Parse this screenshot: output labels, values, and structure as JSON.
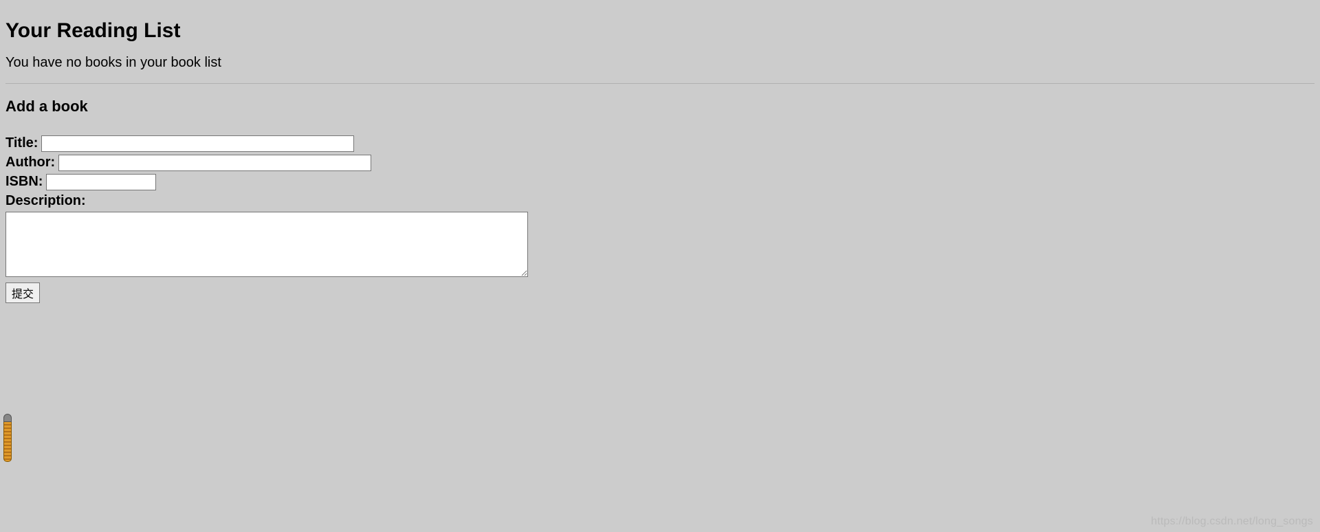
{
  "heading": "Your Reading List",
  "emptyMessage": "You have no books in your book list",
  "form": {
    "heading": "Add a book",
    "labels": {
      "title": "Title:",
      "author": "Author:",
      "isbn": "ISBN:",
      "description": "Description:"
    },
    "values": {
      "title": "",
      "author": "",
      "isbn": "",
      "description": ""
    },
    "submitLabel": "提交"
  },
  "watermark": "https://blog.csdn.net/long_songs"
}
